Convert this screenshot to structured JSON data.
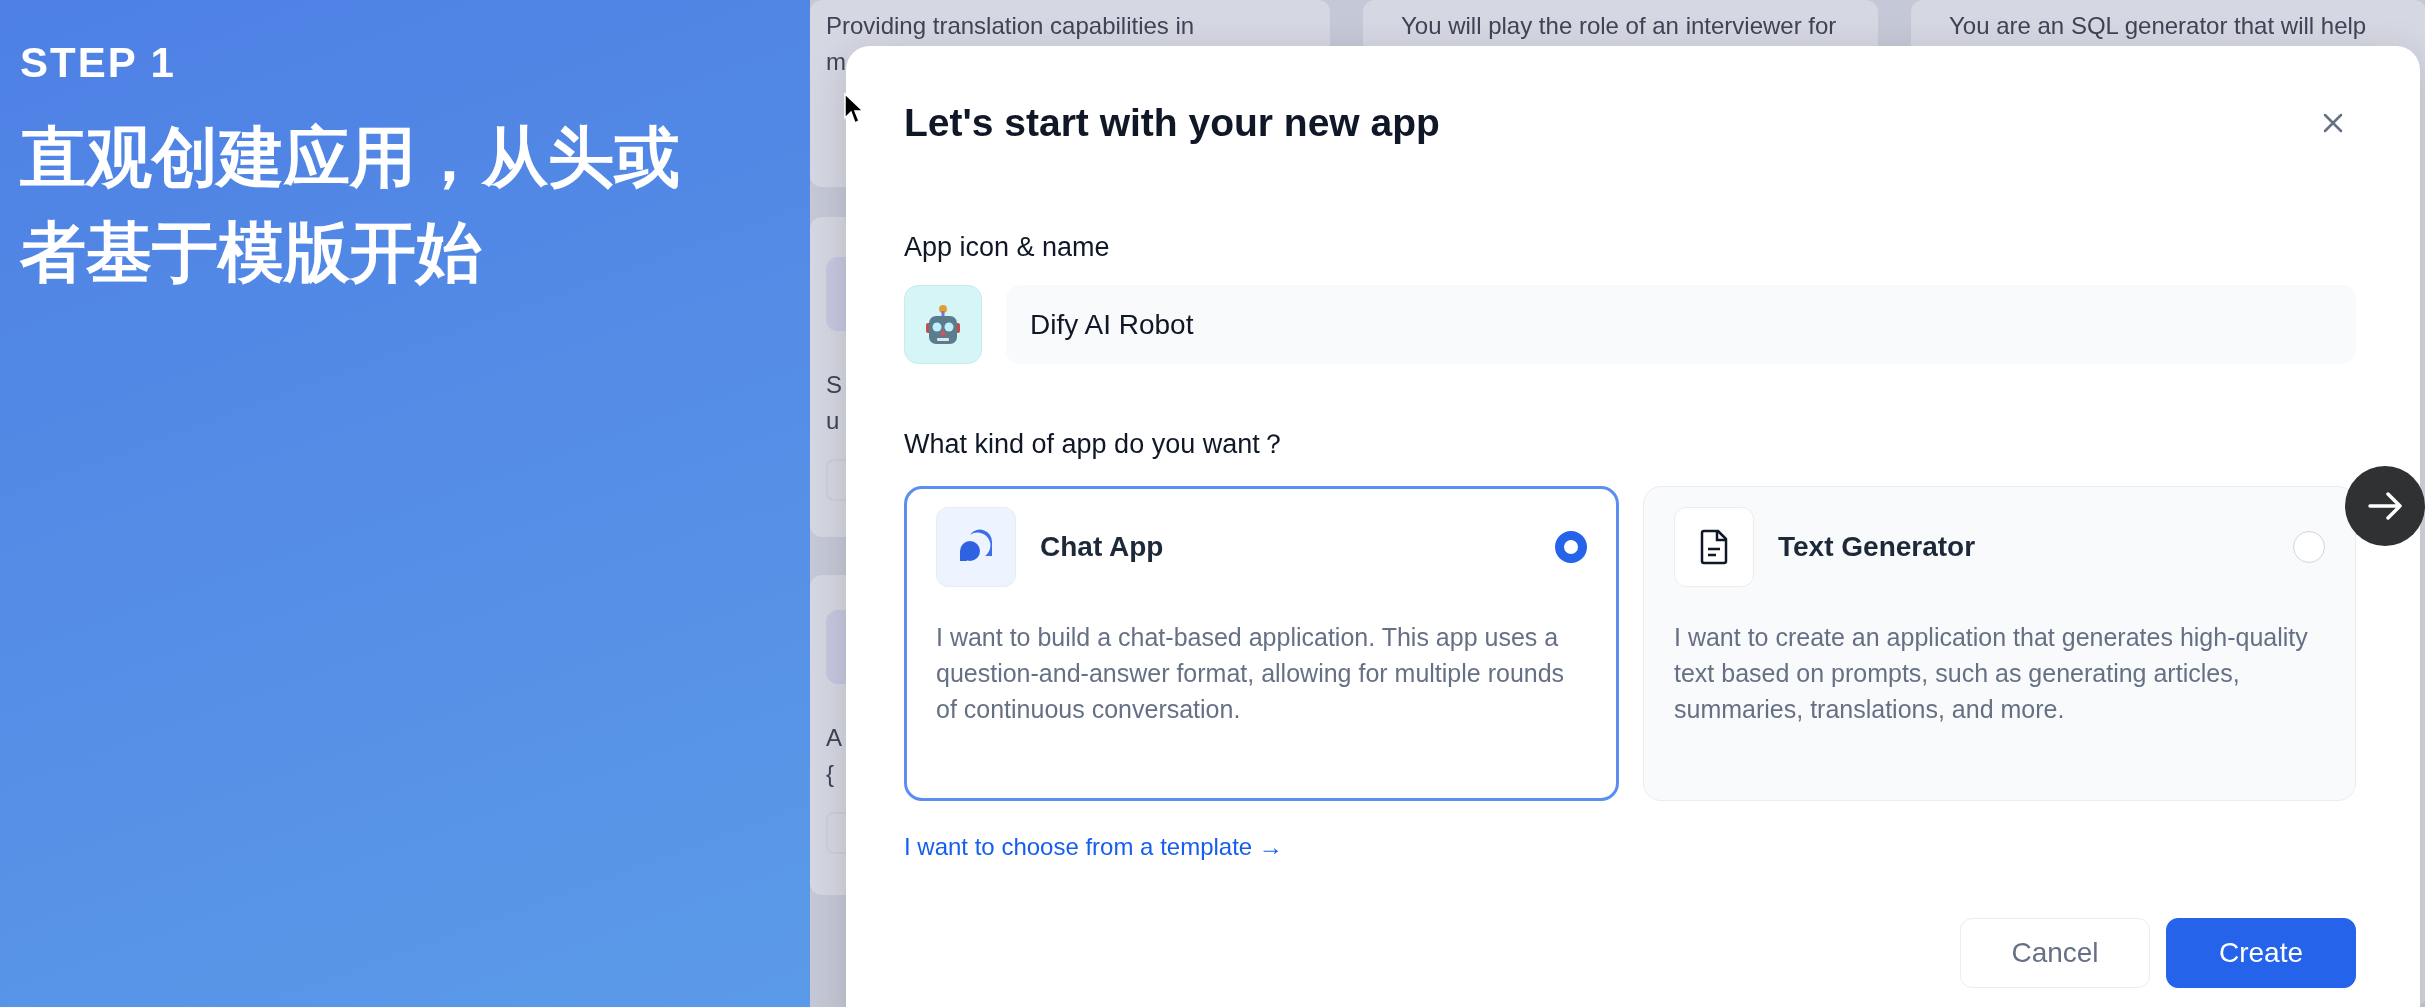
{
  "intro": {
    "step": "STEP 1",
    "headline": "直观创建应用，从头或者基于模版开始"
  },
  "background_columns": [
    {
      "cards": [
        {
          "lines": [
            "Providing translation capabilities in",
            "m"
          ]
        },
        {
          "lines": [
            "S",
            "u"
          ]
        },
        {
          "lines": [
            "A",
            "{"
          ]
        }
      ]
    },
    {
      "cards": [
        {
          "lines": [
            "You will play the role of an interviewer for"
          ]
        }
      ]
    },
    {
      "cards": [
        {
          "lines": [
            "You are an SQL generator that will help"
          ]
        }
      ]
    }
  ],
  "dialog": {
    "title": "Let's start with your new app",
    "name_label": "App icon & name",
    "app_name": "Dify AI Robot",
    "type_label": "What kind of app do you want？",
    "app_types": [
      {
        "kind": "chat",
        "title": "Chat App",
        "description": "I want to build a chat-based application. This app uses a question-and-answer format, allowing for multiple rounds of continuous conversation.",
        "selected": true
      },
      {
        "kind": "text",
        "title": "Text Generator",
        "description": "I want to create an application that generates high-quality text based on prompts, such as generating articles, summaries, translations, and more.",
        "selected": false
      }
    ],
    "template_link": "I want to choose from a template →",
    "buttons": [
      {
        "kind": "secondary",
        "label": "Cancel"
      },
      {
        "kind": "primary",
        "label": "Create"
      }
    ]
  }
}
